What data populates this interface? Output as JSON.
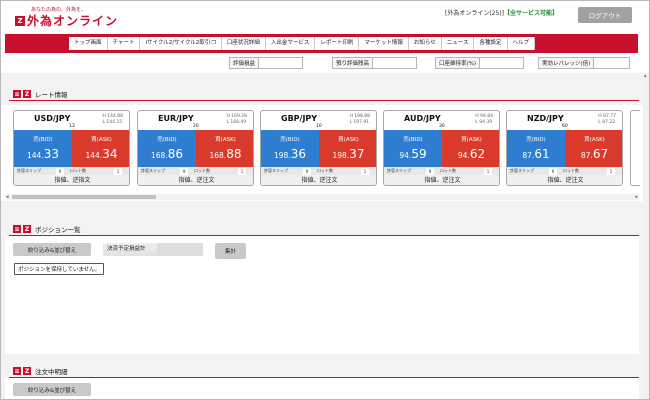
{
  "header": {
    "tagline": "あなたの為の、外為を。",
    "logo_mark": "Z",
    "logo_text": "外為オンライン",
    "account_text": "[外為オンライン(25)]",
    "service_text": "【全サービス可能】",
    "logout_label": "ログアウト"
  },
  "nav": {
    "items": [
      "トップ画面",
      "チャート",
      "iサイクル2/サイクル2取引",
      "口座状況詳細",
      "入出金サービス",
      "レポート印刷",
      "マーケット情報",
      "お知らせ",
      "ニュース",
      "各種設定",
      "ヘルプ"
    ],
    "ext_icon": "❐"
  },
  "info": {
    "eval_pl": "評価損益",
    "eval_balance": "預り評価残高",
    "margin_rate": "口座維持率(%)",
    "leverage": "実効レバレッジ(倍)"
  },
  "sections": {
    "rate": "レート情報",
    "position": "ポジション一覧",
    "order": "注文中明細",
    "icon1": "≡",
    "icon2": "Z"
  },
  "rate_cards": [
    {
      "pair": "USD/JPY",
      "high": "H 144.88",
      "low": "L 144.15",
      "spread": "13",
      "bid_label": "売(BID)",
      "bid_small": "144.",
      "bid_large": "33",
      "ask_label": "買(ASK)",
      "ask_small": "144.",
      "ask_large": "34",
      "slip_label": "許容スリップ",
      "slip_val": "9",
      "lot_label": "ロット数",
      "lot_val": "1",
      "action": "指値、逆指文"
    },
    {
      "pair": "EUR/JPY",
      "high": "H 169.28",
      "low": "L 168.49",
      "spread": "20",
      "bid_label": "売(BID)",
      "bid_small": "168.",
      "bid_large": "86",
      "ask_label": "買(ASK)",
      "ask_small": "168.",
      "ask_large": "88",
      "slip_label": "許容スリップ",
      "slip_val": "9",
      "lot_label": "ロット数",
      "lot_val": "1",
      "action": "指値、逆注文"
    },
    {
      "pair": "GBP/JPY",
      "high": "H 198.88",
      "low": "L 197.91",
      "spread": "10",
      "bid_label": "売(BID)",
      "bid_small": "198.",
      "bid_large": "36",
      "ask_label": "買(ASK)",
      "ask_small": "198.",
      "ask_large": "37",
      "slip_label": "許容スリップ",
      "slip_val": "9",
      "lot_label": "ロット数",
      "lot_val": "1",
      "action": "指値、逆注文"
    },
    {
      "pair": "AUD/JPY",
      "high": "H 94.84",
      "low": "L 94.39",
      "spread": "30",
      "bid_label": "売(BID)",
      "bid_small": "94.",
      "bid_large": "59",
      "ask_label": "買(ASK)",
      "ask_small": "94.",
      "ask_large": "62",
      "slip_label": "許容スリップ",
      "slip_val": "9",
      "lot_label": "ロット数",
      "lot_val": "1",
      "action": "指値、逆注文"
    },
    {
      "pair": "NZD/JPY",
      "high": "H 87.77",
      "low": "L 87.22",
      "spread": "60",
      "bid_label": "売(BID)",
      "bid_small": "87.",
      "bid_large": "61",
      "ask_label": "買(ASK)",
      "ask_small": "87.",
      "ask_large": "67",
      "slip_label": "許容スリップ",
      "slip_val": "9",
      "lot_label": "ロット数",
      "lot_val": "1",
      "action": "指値、逆注文"
    }
  ],
  "position": {
    "filter_label": "絞り込み&並び替え",
    "pl_label": "決済予定損益計",
    "sum_label": "集計",
    "empty_text": "ポジションを保持していません。"
  },
  "order": {
    "filter_label": "絞り込み&並び替え"
  }
}
